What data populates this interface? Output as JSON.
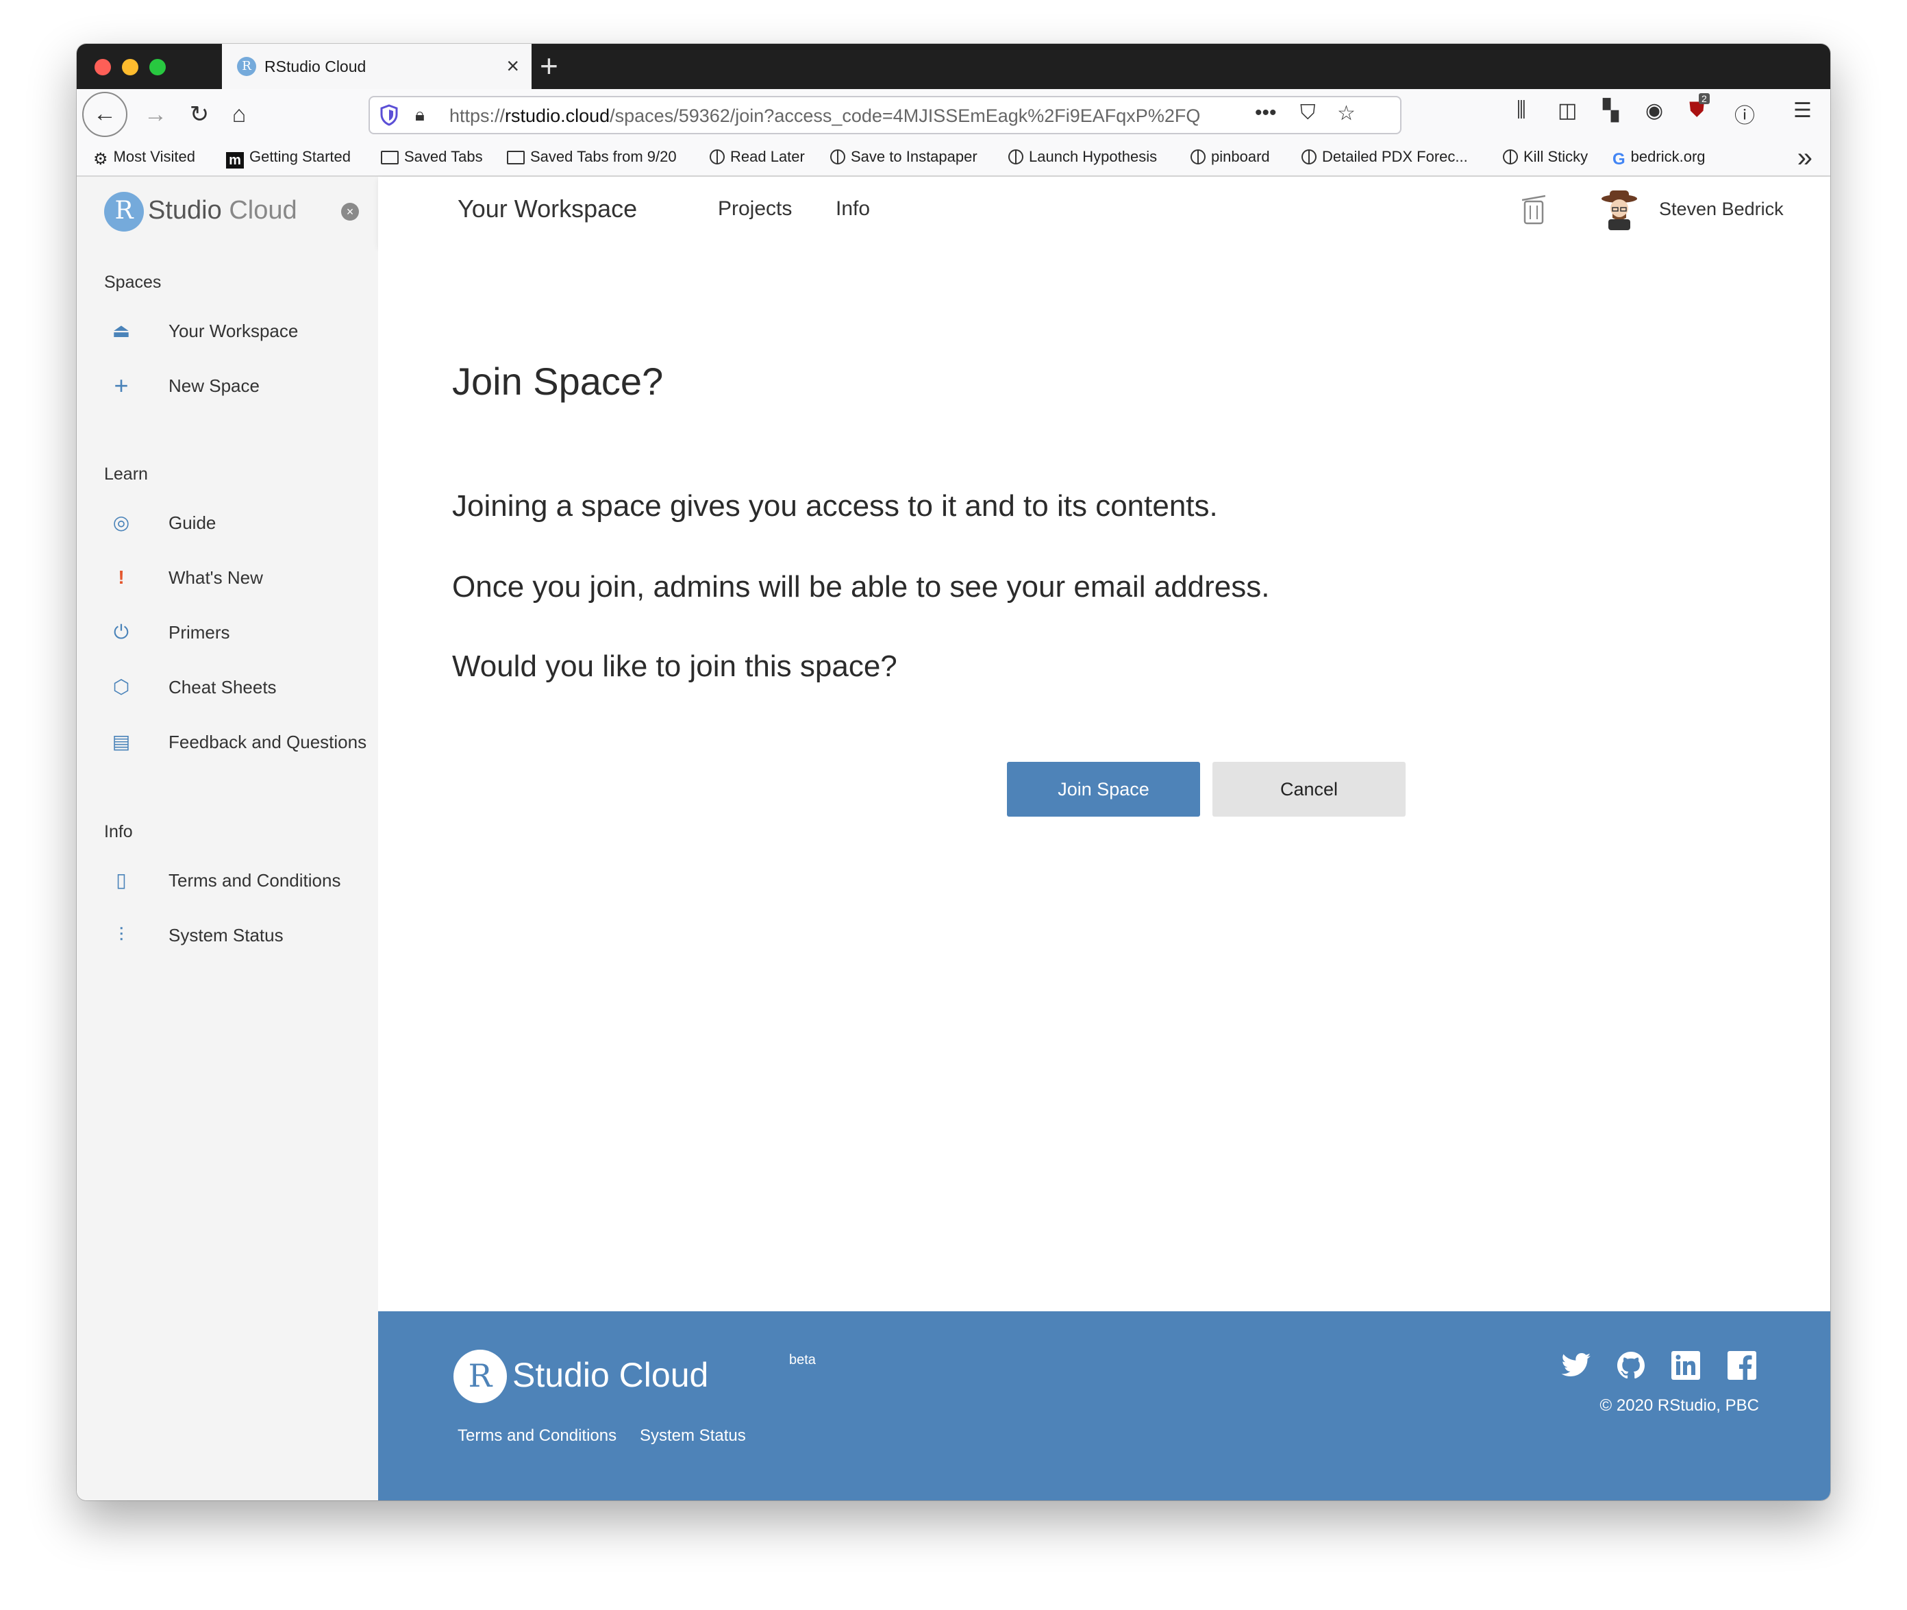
{
  "browser": {
    "tab_title": "RStudio Cloud",
    "tab_favicon": "R",
    "url_prefix": "https://",
    "url_domain": "rstudio.cloud",
    "url_path": "/spaces/59362/join?access_code=4MJISSEmEagk%2Fi9EAFqxP%2FQ",
    "notification_count": "2",
    "bookmarks": [
      "Most Visited",
      "Getting Started",
      "Saved Tabs",
      "Saved Tabs from 9/20",
      "Read Later",
      "Save to Instapaper",
      "Launch Hypothesis",
      "pinboard",
      "Detailed PDX Forec...",
      "Kill Sticky",
      "bedrick.org"
    ]
  },
  "sidebar": {
    "logo_r": "R",
    "logo_studio": "Studio",
    "logo_cloud": "Cloud",
    "spaces_heading": "Spaces",
    "your_workspace": "Your Workspace",
    "new_space": "New Space",
    "learn_heading": "Learn",
    "guide": "Guide",
    "whats_new": "What's New",
    "primers": "Primers",
    "cheat_sheets": "Cheat Sheets",
    "feedback": "Feedback and Questions",
    "info_heading": "Info",
    "terms": "Terms and Conditions",
    "system_status": "System Status"
  },
  "topbar": {
    "workspace": "Your Workspace",
    "projects": "Projects",
    "info": "Info",
    "user_name": "Steven Bedrick"
  },
  "main": {
    "title": "Join Space?",
    "line1": "Joining a space gives you access to it and to its contents.",
    "line2": "Once you join, admins will be able to see your email address.",
    "line3": "Would you like to join this space?",
    "join_button": "Join Space",
    "cancel_button": "Cancel"
  },
  "footer": {
    "logo_r": "R",
    "logo_text": "Studio Cloud",
    "beta": "beta",
    "terms": "Terms and Conditions",
    "system_status": "System Status",
    "copyright": "© 2020 RStudio, PBC"
  },
  "colors": {
    "accent": "#4e83b8",
    "logo_blue": "#75aadb",
    "sidebar_bg": "#f4f4f4"
  }
}
